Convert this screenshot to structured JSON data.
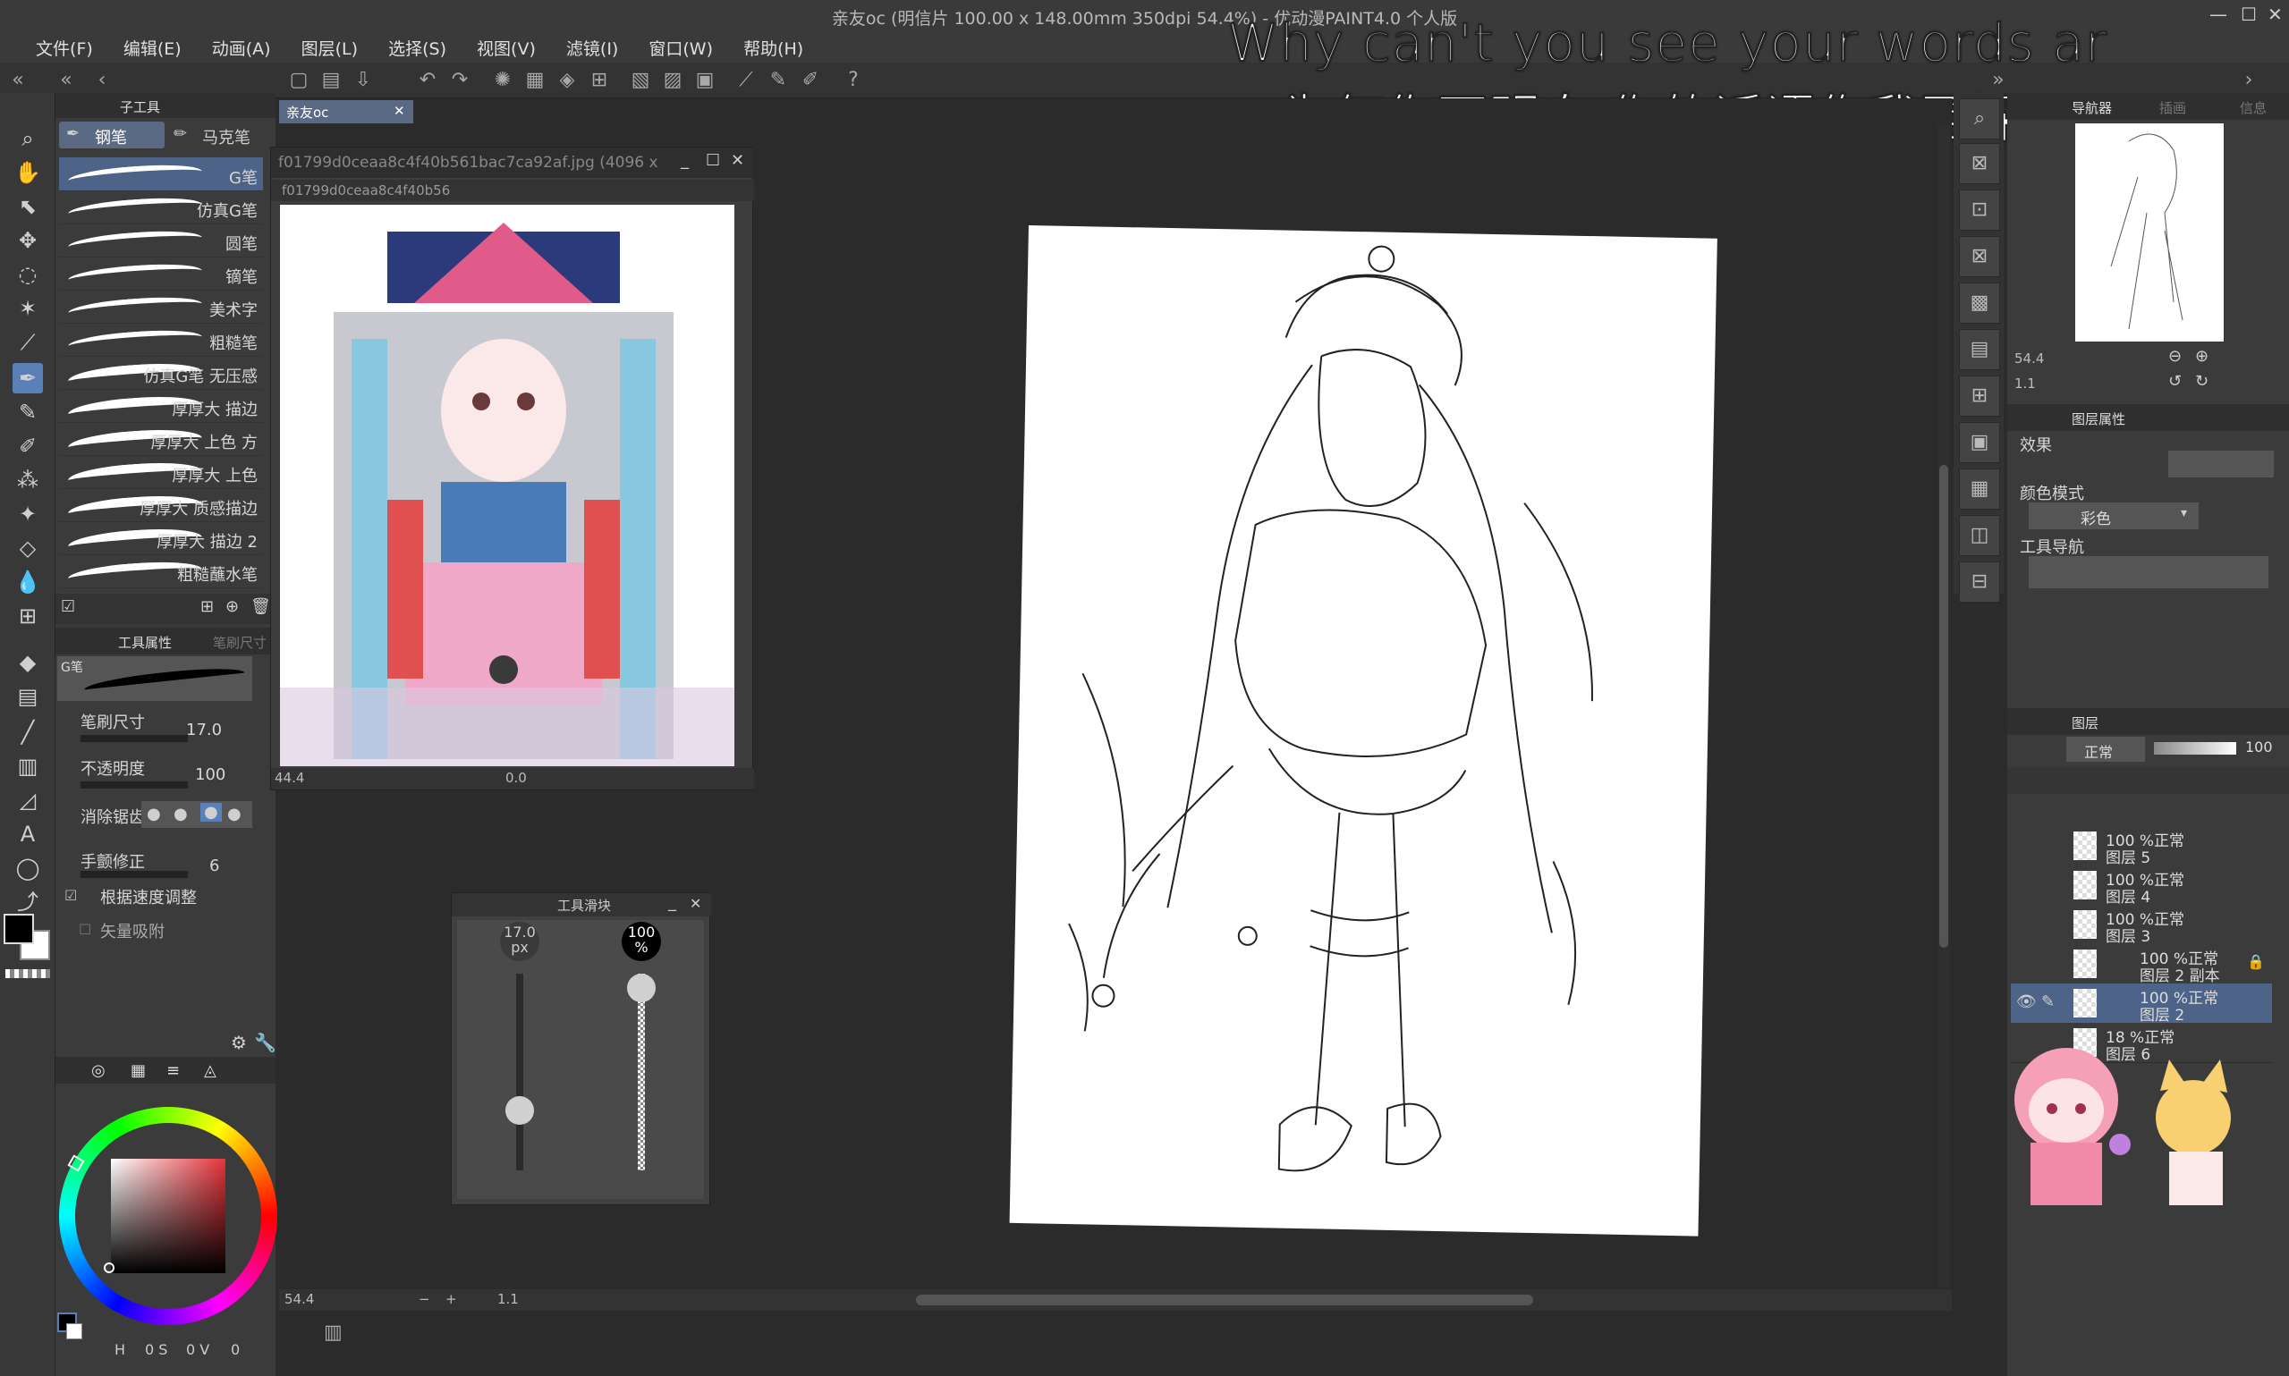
{
  "window": {
    "title": "亲友oc (明信片 100.00 x 148.00mm 350dpi 54.4%) - 优动漫PAINT4.0 个人版"
  },
  "menu": [
    "文件(F)",
    "编辑(E)",
    "动画(A)",
    "图层(L)",
    "选择(S)",
    "视图(V)",
    "滤镜(I)",
    "窗口(W)",
    "帮助(H)"
  ],
  "lyrics": {
    "line1": "Why can't you see your words ar",
    "line2": "为何你不明白 你的话语伤我至深"
  },
  "subtool": {
    "panel_title": "子工具",
    "tabs": [
      "钢笔",
      "马克笔"
    ],
    "brushes": [
      "G笔",
      "仿真G笔",
      "圆笔",
      "镝笔",
      "美术字",
      "粗糙笔",
      "仿真G笔 无压感",
      "厚厚大 描边",
      "厚厚大 上色 方",
      "厚厚大 上色",
      "厚厚大 质感描边",
      "厚厚大 描边 2",
      "粗糙蘸水笔"
    ]
  },
  "tool_property": {
    "tabs": [
      "工具属性",
      "笔刷尺寸"
    ],
    "current": "G笔",
    "rows": [
      {
        "label": "笔刷尺寸",
        "value": "17.0"
      },
      {
        "label": "不透明度",
        "value": "100"
      },
      {
        "label": "消除锯齿",
        "value": ""
      },
      {
        "label": "手颤修正",
        "value": "6"
      }
    ],
    "checkbox1": "根据速度调整",
    "checkbox2": "矢量吸附"
  },
  "document_tab": {
    "label": "亲友oc"
  },
  "reference_window": {
    "title": "f01799d0ceaa8c4f40b561bac7ca92af.jpg (4096 x",
    "tab": "f01799d0ceaa8c4f40b56",
    "zoom": "44.4",
    "angle": "0.0"
  },
  "slider_panel": {
    "title": "工具滑块",
    "size_value": "17.0",
    "size_unit": "px",
    "opacity_value": "100",
    "opacity_unit": "%",
    "size_level": 0.27,
    "opacity_level": 1.0
  },
  "status_bar": {
    "zoom": "54.4",
    "angle": "1.1"
  },
  "navigator": {
    "tabs": [
      "导航器",
      "插画",
      "信息"
    ],
    "zoom": "54.4",
    "angle": "1.1"
  },
  "layer_property": {
    "tabs": [
      "图层属性"
    ],
    "effect_label": "效果",
    "color_mode_label": "颜色模式",
    "color_mode_value": "彩色",
    "tool_nav_label": "工具导航"
  },
  "layers": {
    "tab": "图层",
    "blend": "正常",
    "opacity": "100",
    "items": [
      {
        "top": "100 %正常",
        "name": "图层 5"
      },
      {
        "top": "100 %正常",
        "name": "图层 4"
      },
      {
        "top": "100 %正常",
        "name": "图层 3"
      },
      {
        "top": "100 %正常",
        "name": "图层 2 副本"
      },
      {
        "top": "100 %正常",
        "name": "图层 2"
      },
      {
        "top": "18 %正常",
        "name": "图层 6"
      }
    ]
  },
  "color": {
    "main": "#000000",
    "sub": "#ffffff",
    "wheel_marker": "#e6333a",
    "readout_h": "H",
    "readout_s": "0 S",
    "readout_v": "0 V",
    "readout_extra": "0"
  },
  "accent": "#5b7fb8"
}
